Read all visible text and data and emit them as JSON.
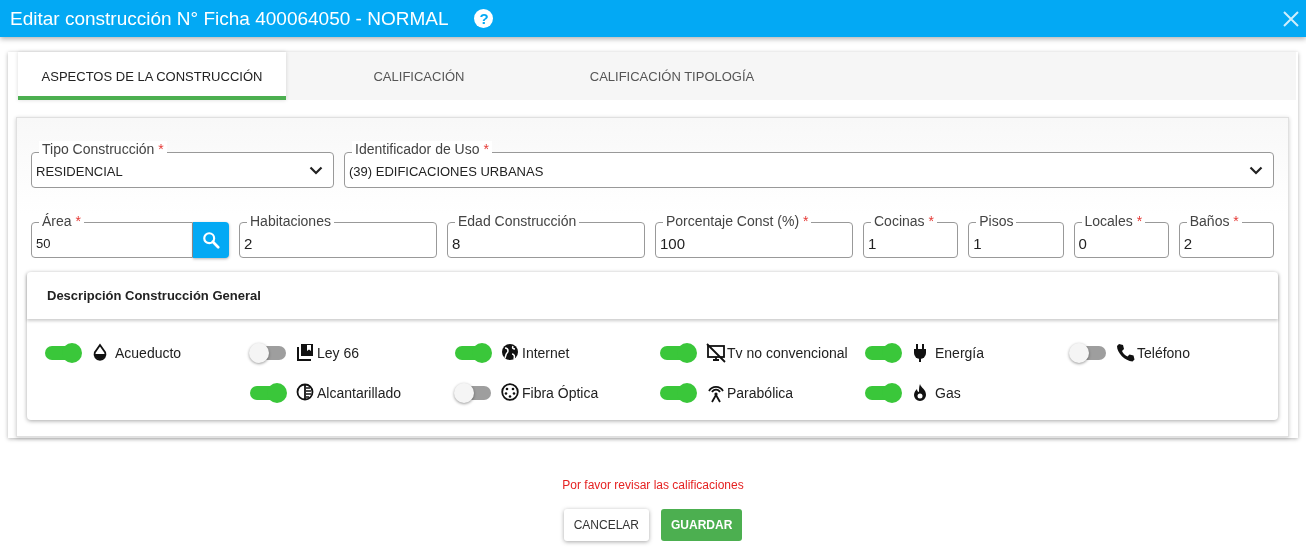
{
  "window": {
    "title": "Editar construcción N° Ficha 400064050 - NORMAL",
    "help": "?"
  },
  "tabs": [
    {
      "label": "ASPECTOS DE LA CONSTRUCCIÓN",
      "selected": true
    },
    {
      "label": "CALIFICACIÓN",
      "selected": false
    },
    {
      "label": "CALIFICACIÓN TIPOLOGÍA",
      "selected": false
    }
  ],
  "fields_row_1": [
    {
      "kind": "select",
      "label": "Tipo Construcción",
      "required_mark": "*",
      "value": "RESIDENCIAL"
    },
    {
      "kind": "select",
      "label": "Identificador de Uso",
      "required_mark": "*",
      "value": "(39) EDIFICACIONES URBANAS"
    }
  ],
  "fields_row_2": [
    {
      "kind": "search",
      "label": "Área",
      "required_mark": "*",
      "value": "50"
    },
    {
      "kind": "text",
      "label": "Habitaciones",
      "value": "2"
    },
    {
      "kind": "text",
      "label": "Edad Construcción",
      "value": "8"
    },
    {
      "kind": "text",
      "label": "Porcentaje Const (%)",
      "required_mark": "*",
      "value": "100"
    },
    {
      "kind": "text",
      "label": "Cocinas",
      "required_mark": "*",
      "value": "1"
    },
    {
      "kind": "text",
      "label": "Pisos",
      "value": "1"
    },
    {
      "kind": "text",
      "label": "Locales",
      "required_mark": "*",
      "value": "0"
    },
    {
      "kind": "text",
      "label": "Baños",
      "required_mark": "*",
      "value": "2"
    }
  ],
  "description": {
    "title": "Descripción Construcción General",
    "services": [
      {
        "label": "Acueducto",
        "on": true
      },
      {
        "label": "Ley 66",
        "on": false
      },
      {
        "label": "Internet",
        "on": true
      },
      {
        "label": "Tv no convencional",
        "on": true
      },
      {
        "label": "Energía",
        "on": true
      },
      {
        "label": "Teléfono",
        "on": false
      },
      {
        "label": "Alcantarillado",
        "on": true
      },
      {
        "label": "Fibra Óptica",
        "on": false
      },
      {
        "label": "Parabólica",
        "on": true
      },
      {
        "label": "Gas",
        "on": true
      }
    ]
  },
  "message": "Por favor revisar las calificaciones",
  "buttons": [
    {
      "label": "CANCELAR",
      "kind": "secondary"
    },
    {
      "label": "GUARDAR",
      "kind": "primary"
    }
  ]
}
